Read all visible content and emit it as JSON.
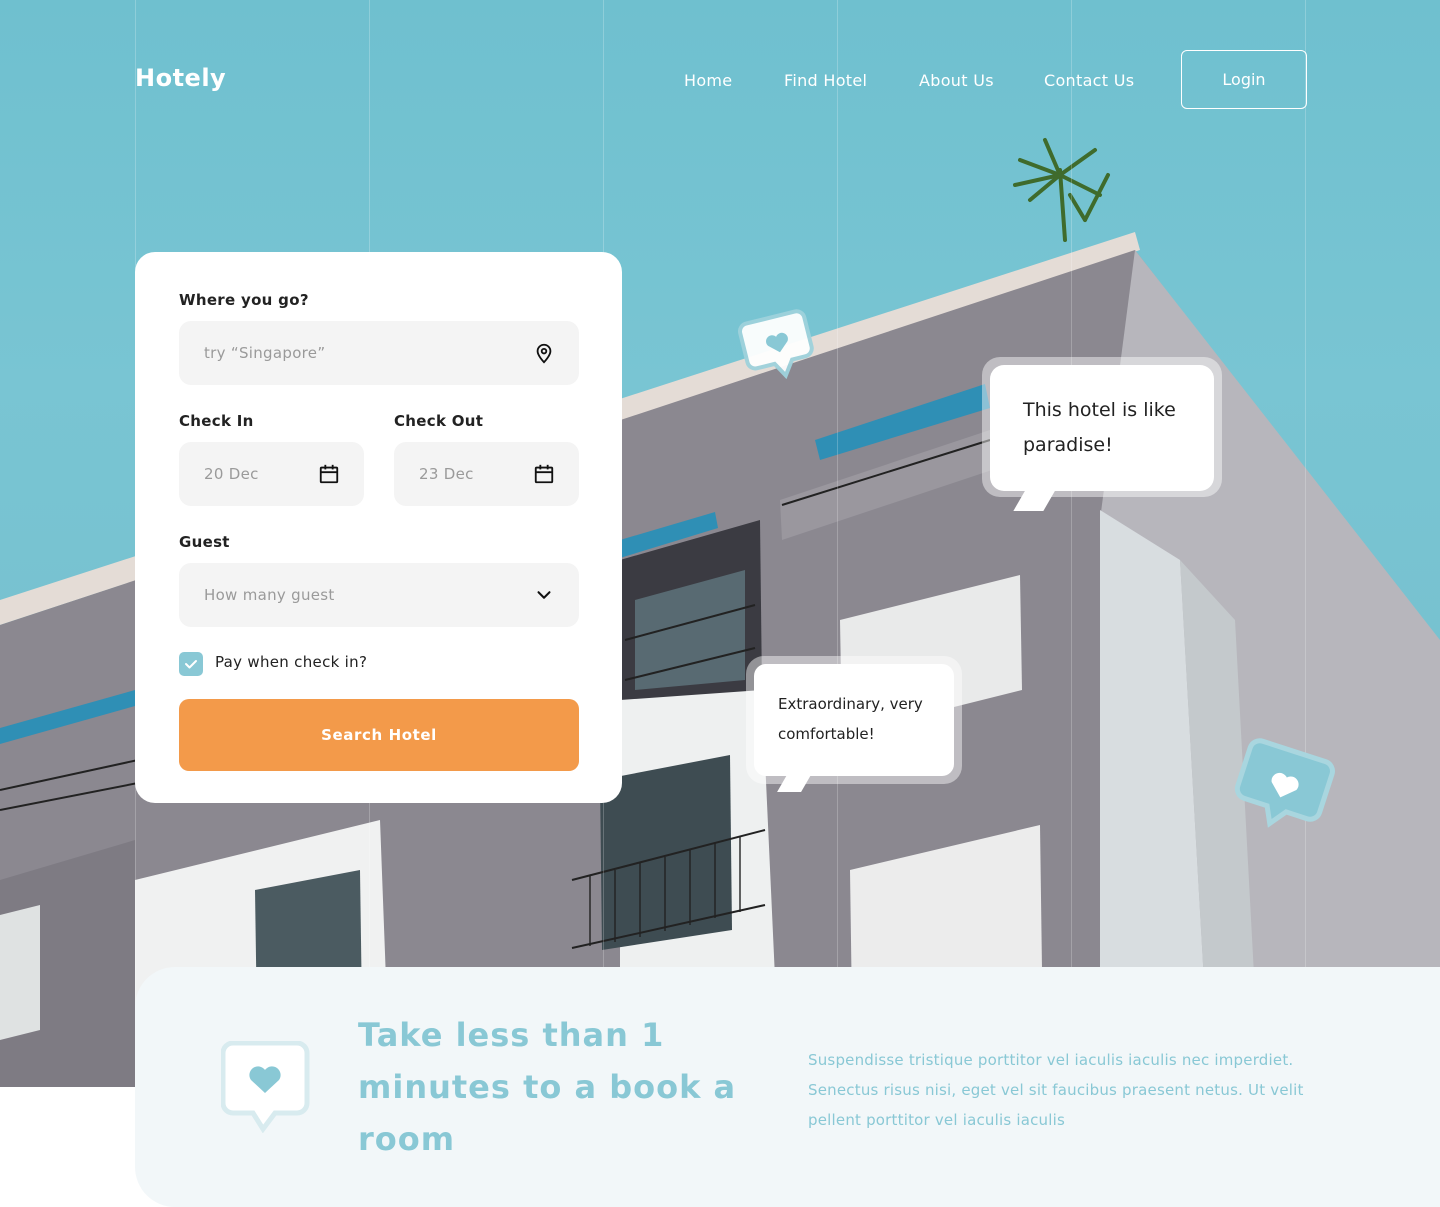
{
  "header": {
    "logo": "Hotely",
    "nav": [
      "Home",
      "Find Hotel",
      "About Us",
      "Contact Us"
    ],
    "login_label": "Login"
  },
  "search": {
    "destination_label": "Where you go?",
    "destination_placeholder": "try “Singapore”",
    "checkin_label": "Check In",
    "checkin_value": "20 Dec",
    "checkout_label": "Check Out",
    "checkout_value": "23 Dec",
    "guest_label": "Guest",
    "guest_placeholder": "How many guest",
    "pay_label": "Pay when check in?",
    "pay_checked": true,
    "submit_label": "Search Hotel"
  },
  "reviews": [
    {
      "text": "This hotel is like paradise!"
    },
    {
      "text": "Extraordinary, very comfortable!"
    }
  ],
  "promo": {
    "heading": "Take less than 1 minutes to a book a room",
    "body": "Suspendisse tristique porttitor vel iaculis iaculis nec imperdiet. Senectus risus nisi, eget vel sit faucibus praesent netus. Ut velit pellent porttitor vel iaculis iaculis"
  },
  "colors": {
    "sky": "#74c0ce",
    "accent": "#89c8d5",
    "cta": "#f39a4a",
    "field": "#f4f4f4",
    "panel": "#f2f7f9"
  },
  "icons": {
    "destination": "location-pin-icon",
    "checkin": "calendar-icon",
    "checkout": "calendar-icon",
    "guest": "chevron-down-icon",
    "check": "check-icon",
    "reaction": "heart-icon"
  }
}
